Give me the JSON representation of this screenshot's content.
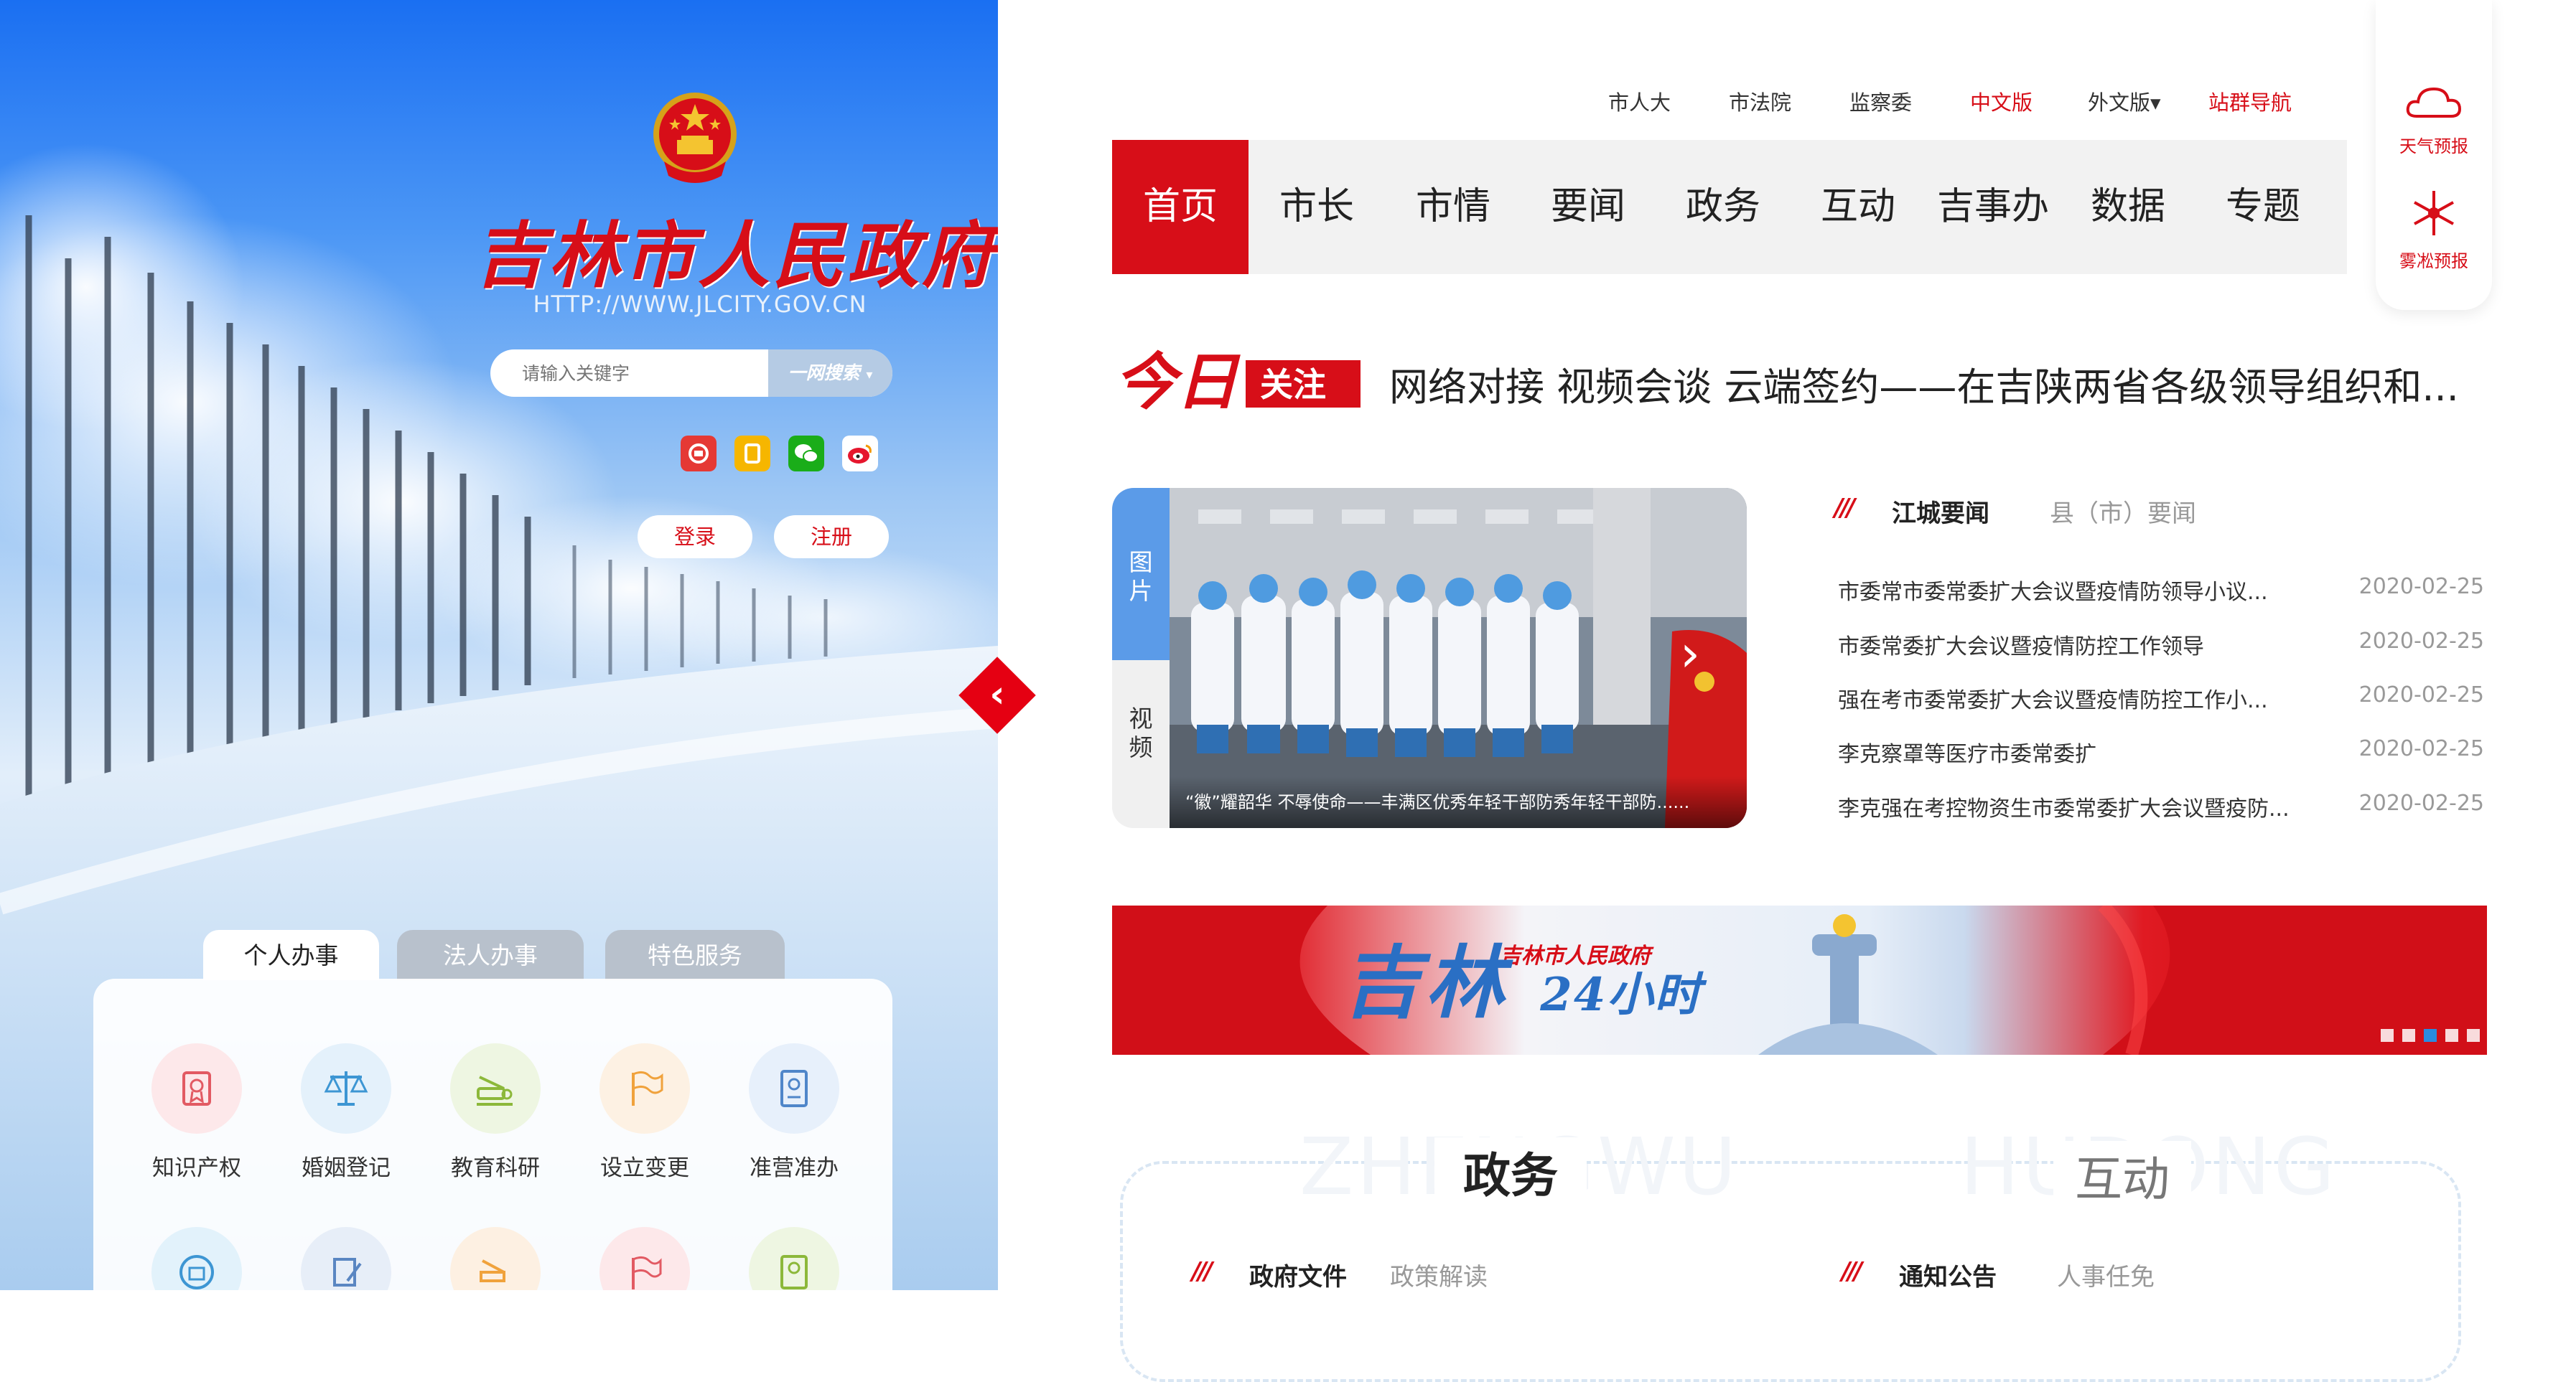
{
  "site": {
    "title": "吉林市人民政府",
    "url": "HTTP://WWW.JLCITY.GOV.CN"
  },
  "search": {
    "placeholder": "请输入关键字",
    "button_label": "一网搜索",
    "caret": "▾"
  },
  "socials": [
    {
      "name": "app-icon",
      "color": "#e53935"
    },
    {
      "name": "mini-program-icon",
      "color": "#f6b600"
    },
    {
      "name": "wechat-icon",
      "color": "#1aad19"
    },
    {
      "name": "weibo-icon",
      "color": "#e6162d"
    }
  ],
  "auth": {
    "login": "登录",
    "register": "注册"
  },
  "collapse_arrow": "‹",
  "services": {
    "tabs": [
      "个人办事",
      "法人办事",
      "特色服务"
    ],
    "items_row1": [
      {
        "label": "知识产权",
        "icon": "certificate-icon",
        "bg": "#fde8ea",
        "color": "#e25a63"
      },
      {
        "label": "婚姻登记",
        "icon": "scales-icon",
        "bg": "#e4f1fb",
        "color": "#3d96d3"
      },
      {
        "label": "教育科研",
        "icon": "microscope-icon",
        "bg": "#eef6e2",
        "color": "#8cb83a"
      },
      {
        "label": "设立变更",
        "icon": "flag-icon",
        "bg": "#fdf1e3",
        "color": "#f0a23c"
      },
      {
        "label": "准营准办",
        "icon": "license-icon",
        "bg": "#e7f0fb",
        "color": "#4f86c9"
      }
    ],
    "items_row2_icons": [
      {
        "icon": "business-icon",
        "bg": "#e2f2fb",
        "color": "#3d96d3"
      },
      {
        "icon": "form-icon",
        "bg": "#e7eef8",
        "color": "#5a86c2"
      },
      {
        "icon": "microscope-icon",
        "bg": "#fdf0e2",
        "color": "#f0a23c"
      },
      {
        "icon": "flag-icon",
        "bg": "#fde8ea",
        "color": "#e25a63"
      },
      {
        "icon": "license-icon",
        "bg": "#eef6e2",
        "color": "#8cb83a"
      }
    ]
  },
  "top_links": [
    {
      "label": "市人大",
      "red": false
    },
    {
      "label": "市法院",
      "red": false
    },
    {
      "label": "监察委",
      "red": false
    },
    {
      "label": "中文版",
      "red": true
    },
    {
      "label": "外文版▾",
      "red": false
    },
    {
      "label": "站群导航",
      "red": true
    }
  ],
  "nav": [
    "首页",
    "市长",
    "市情",
    "要闻",
    "政务",
    "互动",
    "吉事办",
    "数据",
    "专题"
  ],
  "side_tools": [
    {
      "label": "天气预报",
      "icon": "cloud-icon"
    },
    {
      "label": "雾凇预报",
      "icon": "snowflake-icon"
    }
  ],
  "today": {
    "logo_left": "今日",
    "logo_right": "关注",
    "headline": "网络对接 视频会谈 云端签约——在吉陕两省各级领导组织和..."
  },
  "media": {
    "tab_image": "图片",
    "tab_video": "视频",
    "caption": "“徽”耀韶华 不辱使命——丰满区优秀年轻干部防秀年轻干部防......",
    "next_arrow": "›"
  },
  "news": {
    "slashes": "///",
    "tab_active": "江城要闻",
    "tab_inactive": "县（市）要闻",
    "items": [
      {
        "title": "市委常市委常委扩大会议暨疫情防领导小议...",
        "date": "2020-02-25"
      },
      {
        "title": "市委常委扩大会议暨疫情防控工作领导",
        "date": "2020-02-25"
      },
      {
        "title": "强在考市委常委扩大会议暨疫情防控工作小...",
        "date": "2020-02-25"
      },
      {
        "title": "李克察罩等医疗市委常委扩",
        "date": "2020-02-25"
      },
      {
        "title": "李克强在考控物资生市委常委扩大会议暨疫防...",
        "date": "2020-02-25"
      }
    ]
  },
  "banner": {
    "title": "吉林",
    "hours": "24小时",
    "sub": "吉林市人民政府",
    "dots": 5,
    "active_dot": 2
  },
  "sections": {
    "left": {
      "title": "政务",
      "watermark": "ZHENGWU",
      "tab_active": "政府文件",
      "tab_inactive": "政策解读"
    },
    "right": {
      "title": "互动",
      "watermark": "HUDONG",
      "tab_active": "通知公告",
      "tab_inactive": "人事任免"
    }
  }
}
